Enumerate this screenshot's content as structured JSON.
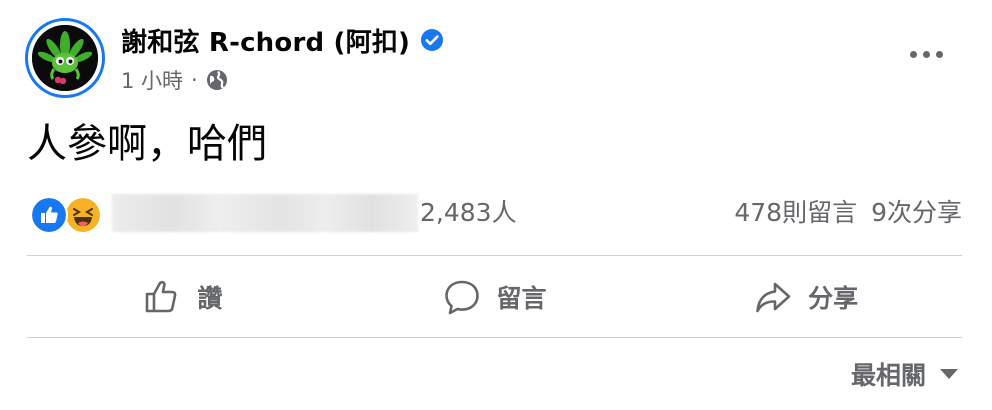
{
  "post": {
    "author": "謝和弦 R-chord (阿扣)",
    "verified_icon": "verified-badge-icon",
    "time": "1 小時",
    "separator": "·",
    "audience_icon": "globe-icon",
    "more_icon": "more-options-icon",
    "text": "人參啊，哈們"
  },
  "engagement": {
    "reaction_icons": [
      "like-reaction-icon",
      "haha-reaction-icon"
    ],
    "reaction_count": "2,483人",
    "comments": "478則留言",
    "shares": "9次分享"
  },
  "actions": {
    "like": {
      "label": "讚",
      "icon": "thumbs-up-icon"
    },
    "comment": {
      "label": "留言",
      "icon": "comment-bubble-icon"
    },
    "share": {
      "label": "分享",
      "icon": "share-arrow-icon"
    }
  },
  "sort": {
    "label": "最相關",
    "icon": "caret-down-icon"
  },
  "colors": {
    "accent": "#1877f2",
    "secondary_text": "#65676b",
    "divider": "#ced0d4",
    "haha": "#f7b125"
  }
}
